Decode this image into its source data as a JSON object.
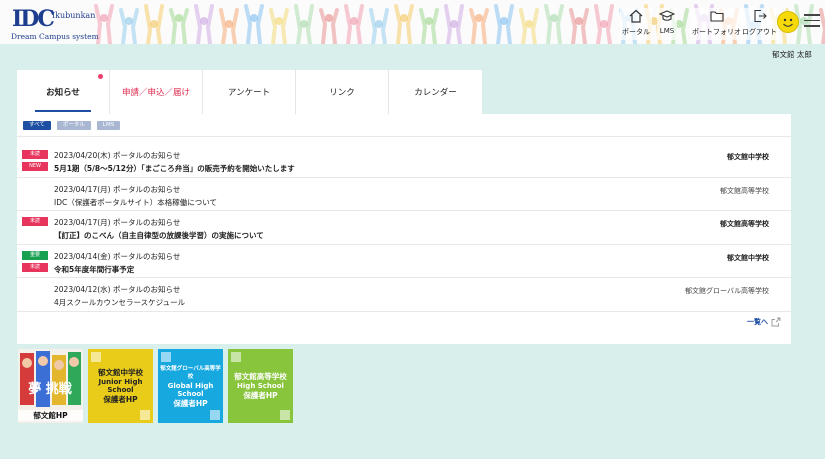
{
  "header": {
    "logo_mark": "IDC",
    "logo_sub_top": "Ikubunkan",
    "logo_sub": "Dream Campus system",
    "nav": [
      {
        "label": "ポータル",
        "icon": "home-icon"
      },
      {
        "label": "LMS",
        "icon": "graduation-cap-icon"
      },
      {
        "label": "ポートフォリオ",
        "icon": "folder-icon"
      },
      {
        "label": "ログアウト",
        "icon": "logout-icon"
      }
    ],
    "username": "郁文館 太郎"
  },
  "tabs": [
    {
      "label": "お知らせ",
      "active": true
    },
    {
      "label": "申請／申込／届け",
      "color": "#e0294f"
    },
    {
      "label": "アンケート"
    },
    {
      "label": "リンク"
    },
    {
      "label": "カレンダー"
    }
  ],
  "filters": [
    "すべて",
    "ポータル",
    "LMS"
  ],
  "news": [
    {
      "badges": [
        "未読",
        "NEW"
      ],
      "meta": "2023/04/20(木) ポータルのお知らせ",
      "title": "5月1期（5/8〜5/12分）「まごころ弁当」の販売予約を開始いたします",
      "school": "郁文館中学校",
      "bold": true
    },
    {
      "badges": [],
      "meta": "2023/04/17(月) ポータルのお知らせ",
      "title": "IDC（保護者ポータルサイト）本格稼働について",
      "school": "郁文館高等学校",
      "bold": false
    },
    {
      "badges": [
        "未読"
      ],
      "meta": "2023/04/17(月) ポータルのお知らせ",
      "title": "【訂正】のこべん（自主自律型の放課後学習）の実施について",
      "school": "郁文館高等学校",
      "bold": true
    },
    {
      "badges": [
        "重要",
        "未読"
      ],
      "meta": "2023/04/14(金) ポータルのお知らせ",
      "title": "令和5年度年間行事予定",
      "school": "郁文館中学校",
      "bold": true
    },
    {
      "badges": [],
      "meta": "2023/04/12(水) ポータルのお知らせ",
      "title": "4月スクールカウンセラースケジュール",
      "school": "郁文館グローバル高等学校",
      "bold": false
    }
  ],
  "more_label": "一覧へ",
  "banners": [
    {
      "type": "photo",
      "label": "郁文館HP"
    },
    {
      "type": "yellow",
      "small": "",
      "l1": "郁文館中学校",
      "l2": "Junior High School",
      "l3": "保護者HP"
    },
    {
      "type": "blue",
      "small": "郁文館グローバル高等学校",
      "l1": "",
      "l2": "Global High School",
      "l3": "保護者HP"
    },
    {
      "type": "green",
      "small": "",
      "l1": "郁文館高等学校",
      "l2": "High School",
      "l3": "保護者HP"
    }
  ],
  "colors": {
    "background": "#d8efec",
    "accent": "#1f4fa3",
    "unread": "#e8355d",
    "important": "#16a050"
  }
}
